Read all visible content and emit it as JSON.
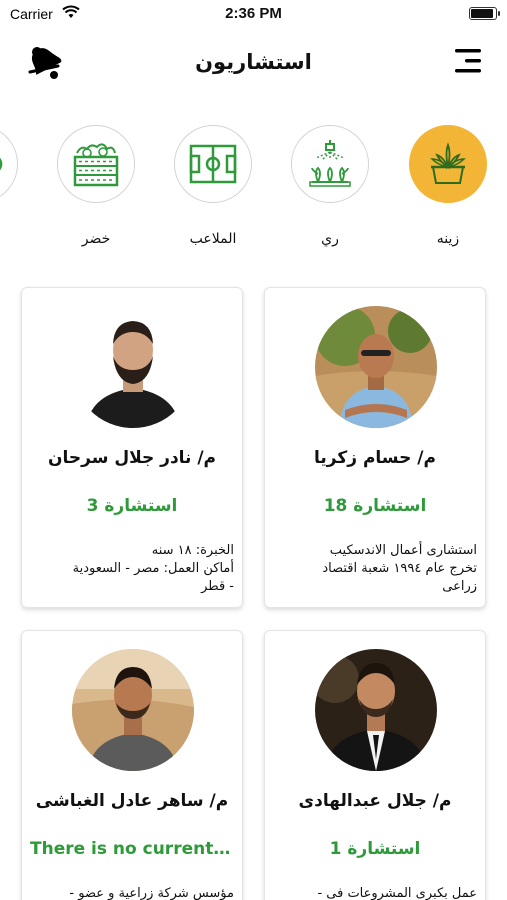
{
  "status_bar": {
    "carrier": "Carrier",
    "time": "2:36 PM"
  },
  "header": {
    "title": "استشاريون",
    "left_icon": "bell-icon",
    "right_icon": "menu-icon"
  },
  "categories": [
    {
      "label": "زينه",
      "icon": "plant-pot-icon",
      "active": true
    },
    {
      "label": "ري",
      "icon": "sprinkler-icon",
      "active": false
    },
    {
      "label": "الملاعب",
      "icon": "field-icon",
      "active": false
    },
    {
      "label": "خضر",
      "icon": "vegetable-crate-icon",
      "active": false
    },
    {
      "label": "",
      "icon": "partial-icon",
      "active": false
    }
  ],
  "consultants": [
    {
      "name": "م/ حسام زكريا",
      "count": "18 استشارة",
      "bio": [
        "استشارى أعمال الاندسكيب",
        "تخرج عام ١٩٩٤ شعبة اقتصاد",
        "زراعى"
      ]
    },
    {
      "name": "م/ نادر جلال سرحان",
      "count": "3 استشارة",
      "bio": [
        "الخبرة: ١٨ سنه",
        "أماكن العمل: مصر - السعودية",
        "- قطر"
      ]
    },
    {
      "name": "م/ جلال عبدالهادى",
      "count": "1 استشارة",
      "bio": [
        "عمل بكبرى المشروعات فى -"
      ]
    },
    {
      "name": "م/ ساهر عادل الغباشى",
      "count": "There is no current c...",
      "bio": [
        "مؤسس شركة زراعية و عضو -"
      ]
    }
  ],
  "colors": {
    "accent_yellow": "#f2b535",
    "green": "#2e9a3a",
    "icon_green": "#2e9a3a"
  }
}
